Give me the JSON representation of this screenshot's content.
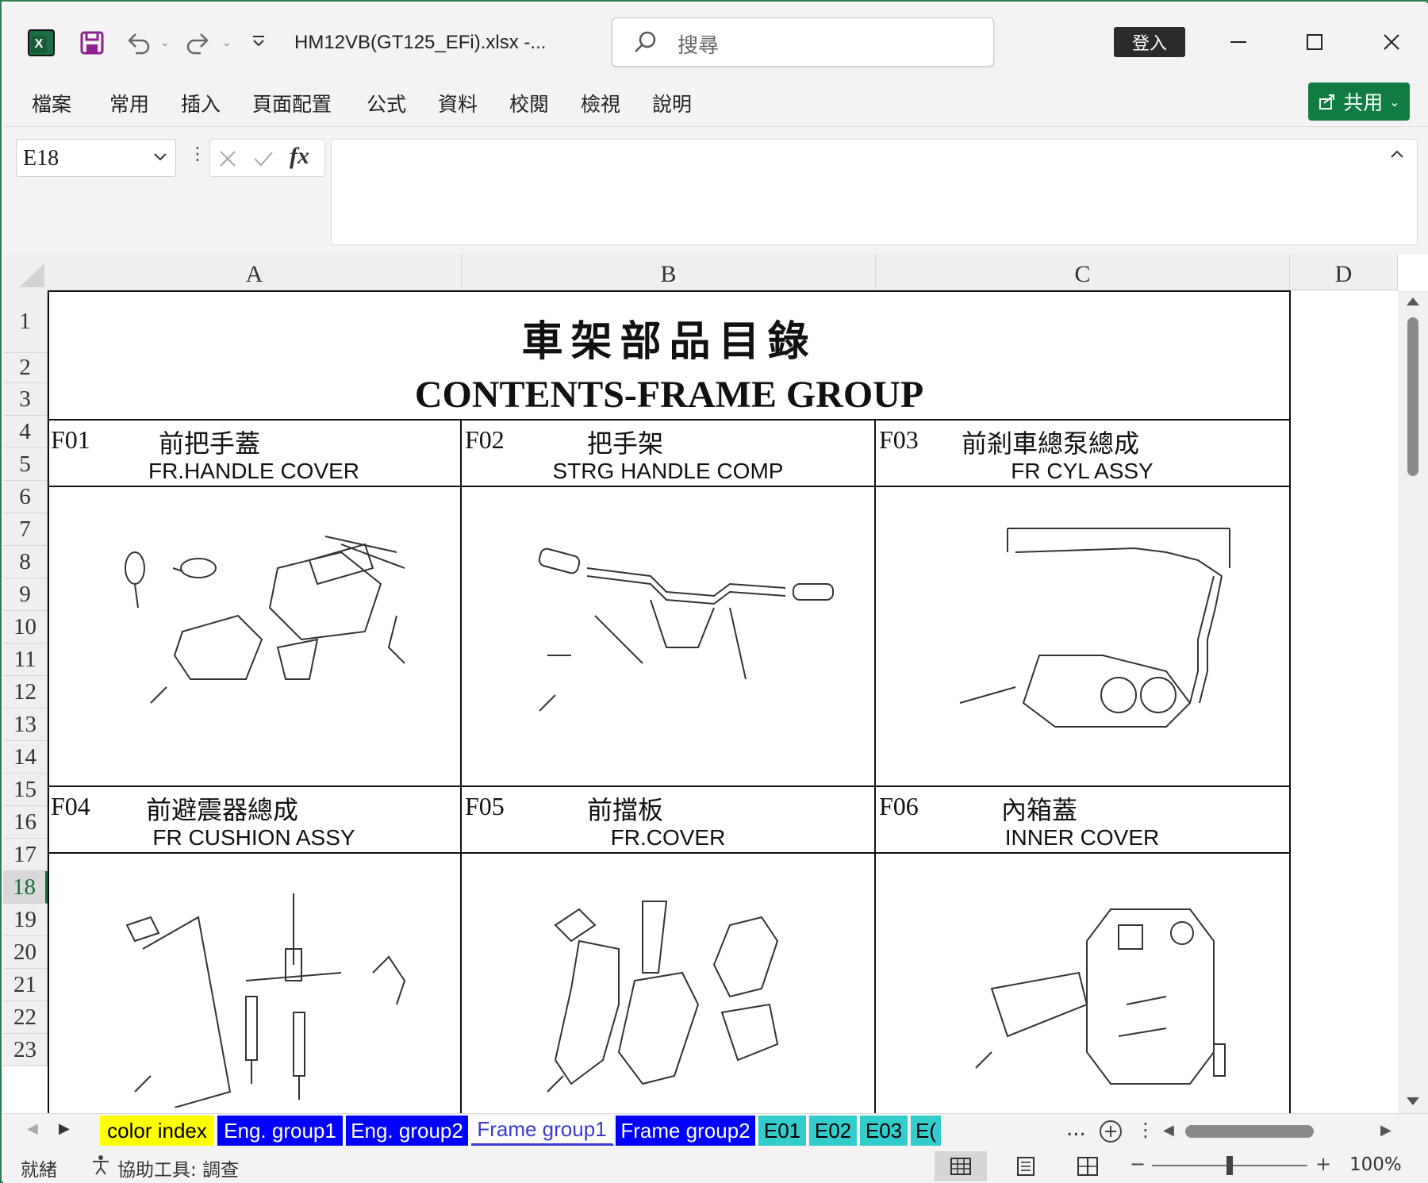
{
  "window": {
    "doc_title": "HM12VB(GT125_EFi).xlsx  -...",
    "search_placeholder": "搜尋",
    "signin_label": "登入"
  },
  "menu": {
    "items": [
      "檔案",
      "常用",
      "插入",
      "頁面配置",
      "公式",
      "資料",
      "校閱",
      "檢視",
      "說明"
    ],
    "share_label": "共用"
  },
  "formula_bar": {
    "name_box": "E18",
    "formula": ""
  },
  "grid": {
    "columns": [
      "A",
      "B",
      "C",
      "D"
    ],
    "rows": [
      "1",
      "2",
      "3",
      "4",
      "5",
      "6",
      "7",
      "8",
      "9",
      "10",
      "11",
      "12",
      "13",
      "14",
      "15",
      "16",
      "17",
      "18",
      "19",
      "20",
      "21",
      "22",
      "23"
    ],
    "selected_row": "18"
  },
  "sheet": {
    "title_zh": "車架部品目錄",
    "title_en": "CONTENTS-FRAME GROUP",
    "parts": [
      {
        "code": "F01",
        "name_zh": "前把手蓋",
        "name_en": "FR.HANDLE COVER"
      },
      {
        "code": "F02",
        "name_zh": "把手架",
        "name_en": "STRG HANDLE COMP"
      },
      {
        "code": "F03",
        "name_zh": "前剎車總泵總成",
        "name_en": "FR CYL ASSY"
      },
      {
        "code": "F04",
        "name_zh": "前避震器總成",
        "name_en": "FR CUSHION ASSY"
      },
      {
        "code": "F05",
        "name_zh": "前擋板",
        "name_en": "FR.COVER"
      },
      {
        "code": "F06",
        "name_zh": "內箱蓋",
        "name_en": "INNER COVER"
      }
    ]
  },
  "tabs": [
    {
      "label": "color index",
      "bg": "#ffff00",
      "fg": "#000000"
    },
    {
      "label": "Eng. group1",
      "bg": "#0000ff",
      "fg": "#ffffff"
    },
    {
      "label": "Eng. group2",
      "bg": "#0000ff",
      "fg": "#ffffff"
    },
    {
      "label": "Frame group1",
      "bg": "#ffffff",
      "fg": "#3a3ad0"
    },
    {
      "label": "Frame group2",
      "bg": "#0000ff",
      "fg": "#ffffff"
    },
    {
      "label": "E01",
      "bg": "#33cccc",
      "fg": "#000000"
    },
    {
      "label": "E02",
      "bg": "#33cccc",
      "fg": "#000000"
    },
    {
      "label": "E03",
      "bg": "#33cccc",
      "fg": "#000000"
    },
    {
      "label": "E(",
      "bg": "#33cccc",
      "fg": "#000000"
    }
  ],
  "tab_overflow": "...",
  "status": {
    "ready": "就緒",
    "accessibility": "協助工具: 調查",
    "zoom": "100%"
  }
}
